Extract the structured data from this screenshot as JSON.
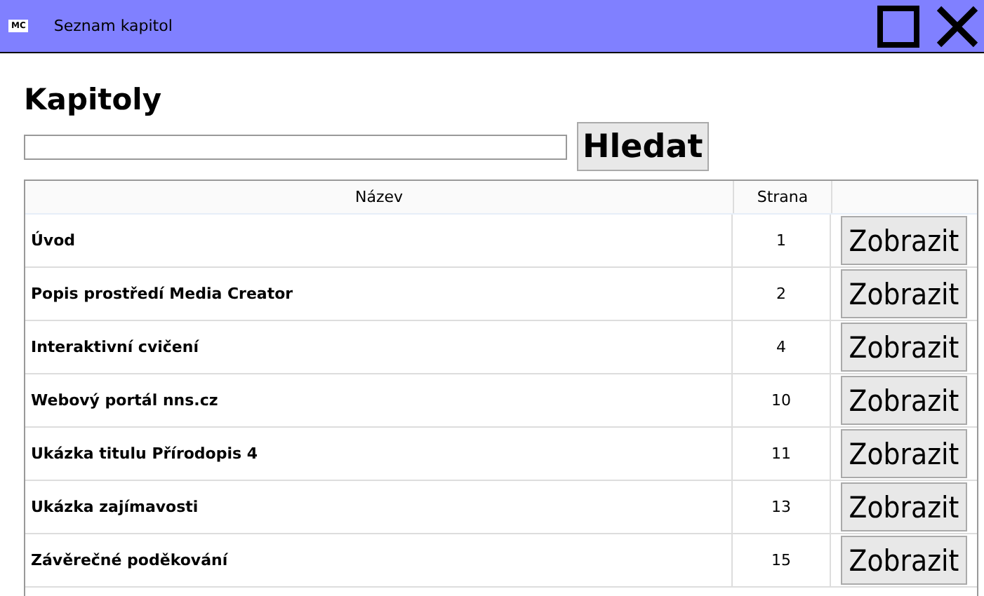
{
  "window": {
    "logo": "MC",
    "title": "Seznam kapitol"
  },
  "heading": "Kapitoly",
  "search": {
    "button": "Hledat"
  },
  "table": {
    "columns": [
      "Název",
      "Strana"
    ],
    "rows": [
      {
        "name": "Úvod",
        "page": "1",
        "action": "Zobrazit"
      },
      {
        "name": "Popis prostředí Media Creator",
        "page": "2",
        "action": "Zobrazit"
      },
      {
        "name": "Interaktivní cvičení",
        "page": "4",
        "action": "Zobrazit"
      },
      {
        "name": "Webový portál nns.cz",
        "page": "10",
        "action": "Zobrazit"
      },
      {
        "name": "Ukázka titulu Přírodopis 4",
        "page": "11",
        "action": "Zobrazit"
      },
      {
        "name": "Ukázka zajímavosti",
        "page": "13",
        "action": "Zobrazit"
      },
      {
        "name": "Závěrečné poděkování",
        "page": "15",
        "action": "Zobrazit"
      }
    ]
  }
}
